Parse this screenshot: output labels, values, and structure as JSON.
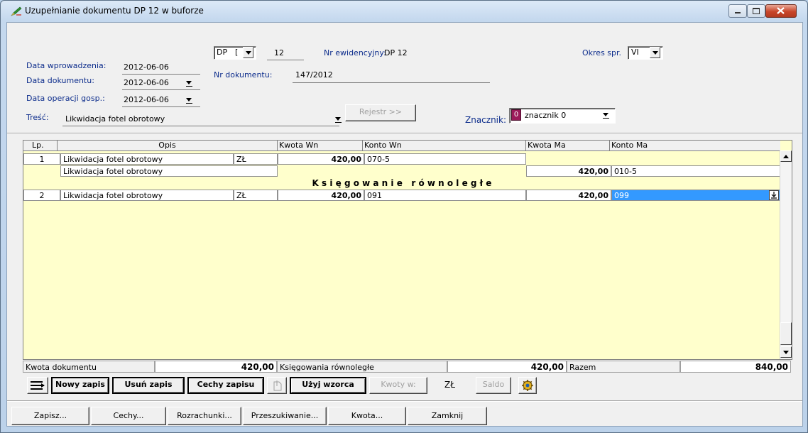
{
  "window": {
    "title": "Uzupełnianie dokumentu DP   12 w buforze",
    "controls": [
      "minimize-icon",
      "maximize-icon",
      "close-icon"
    ]
  },
  "header": {
    "data_wprowadzenia_label": "Data wprowadzenia:",
    "data_wprowadzenia": "2012-06-06",
    "data_dokumentu_label": "Data dokumentu:",
    "data_dokumentu": "2012-06-06",
    "data_operacji_label": "Data operacji gosp.:",
    "data_operacji": "2012-06-06",
    "tresc_label": "Treść:",
    "tresc": "Likwidacja fotel obrotowy",
    "doc_type": "DP",
    "doc_type_suffix": "[",
    "doc_number": "12",
    "nr_ewidencyjny_label": "Nr ewidencyjny:",
    "nr_ewidencyjny": "DP   12",
    "nr_dokumentu_label": "Nr dokumentu:",
    "nr_dokumentu": "147/2012",
    "okres_label": "Okres spr.",
    "okres": "VI",
    "rejestr_label": "Rejestr >>",
    "znacznik_label": "Znacznik:",
    "znacznik": "znacznik 0",
    "znacznik_code": "0",
    "znacznik_color": "#9b1b5a"
  },
  "grid": {
    "columns": [
      "Lp.",
      "Opis",
      "Kwota Wn",
      "Konto Wn",
      "Kwota Ma",
      "Konto Ma"
    ],
    "rows": [
      {
        "lp": "1",
        "opis": "Likwidacja fotel obrotowy",
        "waluta": "ZŁ",
        "kwota_wn": "420,00",
        "konto_wn": "070-5",
        "kwota_ma": "",
        "konto_ma": ""
      },
      {
        "lp": "",
        "opis": "Likwidacja fotel obrotowy",
        "waluta": "",
        "kwota_wn": "",
        "konto_wn": "",
        "kwota_ma": "420,00",
        "konto_ma": "010-5"
      },
      {
        "lp": "2",
        "opis": "Likwidacja fotel obrotowy",
        "waluta": "ZŁ",
        "kwota_wn": "420,00",
        "konto_wn": "091",
        "kwota_ma": "420,00",
        "konto_ma": "099"
      }
    ],
    "section_label": "K s i ę g o w a n i e   r ó w n o l e g ł e",
    "background": "#ffffcc",
    "selection_color": "#3399ff"
  },
  "totals": {
    "kwota_dokumentu_label": "Kwota dokumentu",
    "kwota_dokumentu": "420,00",
    "ksiegowania_label": "Księgowania równoległe",
    "ksiegowania": "420,00",
    "razem_label": "Razem",
    "razem": "840,00"
  },
  "toolbar": {
    "nowy_zapis": "Nowy zapis",
    "usun_zapis": "Usuń zapis",
    "cechy_zapisu": "Cechy zapisu",
    "uzyj_wzorca": "Użyj wzorca",
    "kwoty_w": "Kwoty w:",
    "waluta": "ZŁ",
    "saldo": "Saldo"
  },
  "footer": {
    "zapisz": "Zapisz...",
    "cechy": "Cechy...",
    "rozrachunki": "Rozrachunki...",
    "przeszukiwanie": "Przeszukiwanie...",
    "kwota": "Kwota...",
    "zamknij": "Zamknij"
  }
}
